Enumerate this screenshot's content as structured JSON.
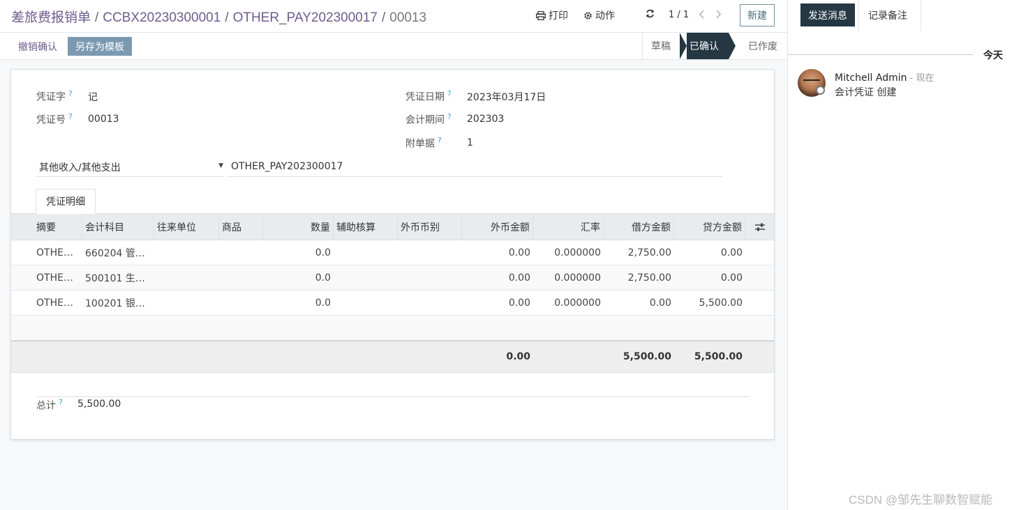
{
  "breadcrumb": {
    "items": [
      "差旅费报销单",
      "CCBX20230300001",
      "OTHER_PAY202300017"
    ],
    "current": "00013"
  },
  "toolbar": {
    "print_label": "打印",
    "action_label": "动作",
    "pager": "1 / 1",
    "new_label": "新建"
  },
  "actions": {
    "undo_label": "撤销确认",
    "template_label": "另存为模板"
  },
  "status": {
    "stages": [
      "草稿",
      "已确认",
      "已作废"
    ],
    "active": "已确认"
  },
  "form": {
    "voucher_word": {
      "label": "凭证字",
      "value": "记"
    },
    "voucher_no": {
      "label": "凭证号",
      "value": "00013"
    },
    "voucher_date": {
      "label": "凭证日期",
      "value": "2023年03月17日"
    },
    "period": {
      "label": "会计期间",
      "value": "202303"
    },
    "attachments": {
      "label": "附单据",
      "value": "1"
    },
    "type_select": "其他收入/其他支出",
    "reference": "OTHER_PAY202300017",
    "help_mark": "?"
  },
  "tab": {
    "label": "凭证明细"
  },
  "table": {
    "headers": [
      "摘要",
      "会计科目",
      "往来单位",
      "商品",
      "数量",
      "辅助核算",
      "外币币别",
      "外币金额",
      "汇率",
      "借方金额",
      "贷方金额"
    ],
    "rows": [
      [
        "OTHE…",
        "660204 管…",
        "",
        "",
        "0.0",
        "",
        "",
        "0.00",
        "0.000000",
        "2,750.00",
        "0.00"
      ],
      [
        "OTHE…",
        "500101 生…",
        "",
        "",
        "0.0",
        "",
        "",
        "0.00",
        "0.000000",
        "2,750.00",
        "0.00"
      ],
      [
        "OTHE…",
        "100201 银…",
        "",
        "",
        "0.0",
        "",
        "",
        "0.00",
        "0.000000",
        "0.00",
        "5,500.00"
      ]
    ],
    "footer": {
      "foreign_total": "0.00",
      "debit_total": "5,500.00",
      "credit_total": "5,500.00"
    }
  },
  "total": {
    "label": "总计",
    "value": "5,500.00"
  },
  "chatter": {
    "send_label": "发送消息",
    "note_label": "记录备注",
    "today_label": "今天",
    "author": "Mitchell Admin",
    "time": " - 现在",
    "message": "会计凭证 创建"
  },
  "watermark": "CSDN @邹先生聊数智赋能",
  "colors": {
    "accent": "#243742",
    "link": "#6e5c8d",
    "help": "#31a8c9"
  }
}
